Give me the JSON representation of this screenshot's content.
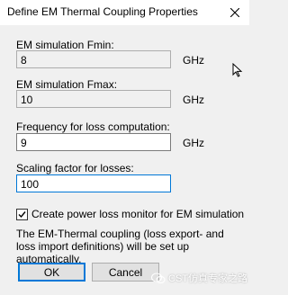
{
  "window": {
    "title": "Define EM Thermal Coupling Properties"
  },
  "fields": [
    {
      "label": "EM simulation Fmin:",
      "value": "8",
      "unit": "GHz",
      "editable": false
    },
    {
      "label": "EM simulation Fmax:",
      "value": "10",
      "unit": "GHz",
      "editable": false
    },
    {
      "label": "Frequency for loss computation:",
      "value": "9",
      "unit": "GHz",
      "editable": true
    },
    {
      "label": "Scaling factor for losses:",
      "value": "100",
      "unit": "",
      "editable": true
    }
  ],
  "checkbox": {
    "label": "Create power loss monitor for EM simulation",
    "checked": true
  },
  "info_text": "The EM-Thermal coupling (loss export- and loss import definitions) will be set up automatically.",
  "buttons": {
    "ok_label": "OK",
    "cancel_label": "Cancel"
  },
  "watermark": {
    "text": "CST仿真专家之路"
  },
  "icons": {
    "close": "close-icon",
    "checkmark": "checkmark-icon",
    "cursor": "resize-cursor-icon",
    "watermark": "wechat-icon"
  },
  "colors": {
    "dialog_background": "#f0f0f0",
    "title_bar": "#ffffff",
    "focus_border": "#0078d7",
    "readonly_field": "#f0f0f0",
    "editable_field": "#ffffff"
  }
}
